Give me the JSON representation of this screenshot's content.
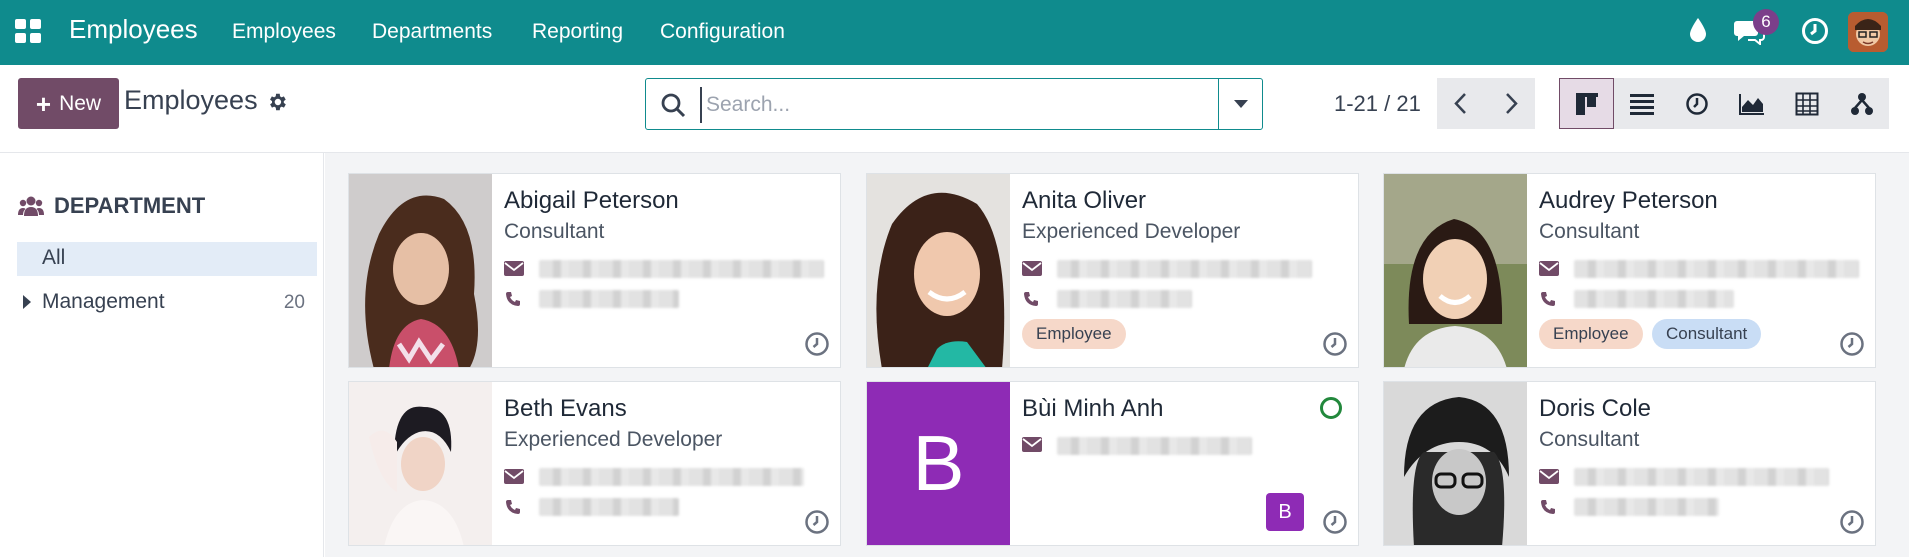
{
  "topbar": {
    "app_title": "Employees",
    "nav": [
      "Employees",
      "Departments",
      "Reporting",
      "Configuration"
    ],
    "chat_badge": "6",
    "icons": [
      "apps-grid-icon",
      "drop-icon",
      "chat-icon",
      "clock-icon",
      "user-avatar"
    ]
  },
  "control": {
    "new_label": "New",
    "breadcrumb": "Employees",
    "search_placeholder": "Search...",
    "pager": "1-21 / 21",
    "views": [
      "kanban-view-icon",
      "list-view-icon",
      "activity-view-icon",
      "graph-view-icon",
      "pivot-view-icon",
      "hierarchy-view-icon"
    ],
    "active_view": "kanban"
  },
  "sidebar": {
    "header": "DEPARTMENT",
    "all_label": "All",
    "items": [
      {
        "label": "Management",
        "count": "20"
      }
    ]
  },
  "employees": [
    {
      "name": "Abigail Peterson",
      "job": "Consultant",
      "tags": []
    },
    {
      "name": "Anita Oliver",
      "job": "Experienced Developer",
      "tags": [
        "Employee"
      ]
    },
    {
      "name": "Audrey Peterson",
      "job": "Consultant",
      "tags": [
        "Employee",
        "Consultant"
      ]
    },
    {
      "name": "Beth Evans",
      "job": "Experienced Developer",
      "tags": []
    },
    {
      "name": "Bùi Minh Anh",
      "job": "",
      "initial": "B",
      "badge": "B",
      "tags": []
    },
    {
      "name": "Doris Cole",
      "job": "Consultant",
      "tags": []
    }
  ],
  "colors": {
    "topbar": "#0f8b8d",
    "brand": "#714b67",
    "initial_avatar": "#8e2bb5",
    "tag_employee": "#f6d8c9",
    "tag_consultant": "#c9ddf5",
    "online": "#22883c"
  }
}
